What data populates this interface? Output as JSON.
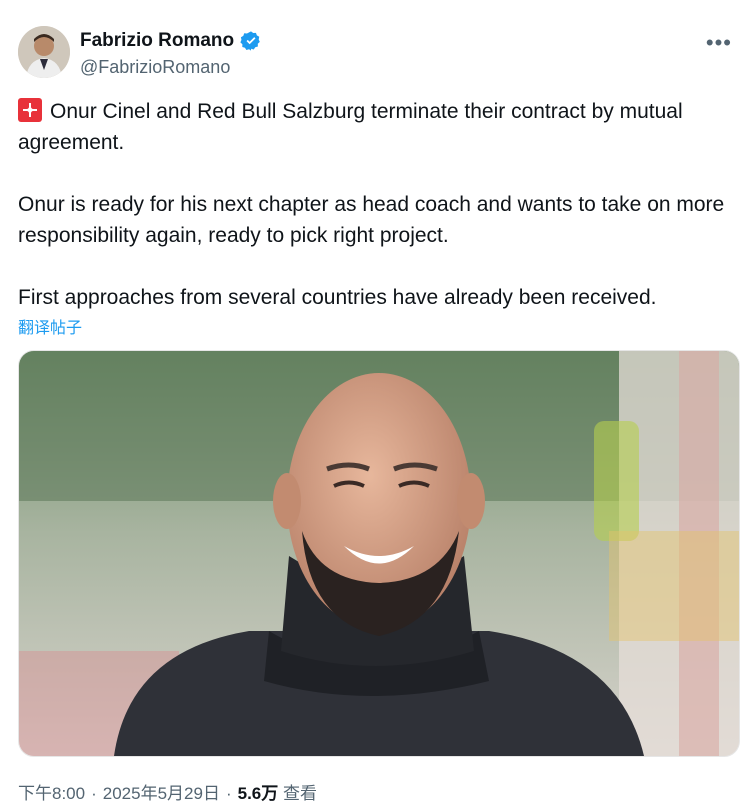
{
  "author": {
    "display_name": "Fabrizio Romano",
    "handle": "@FabrizioRomano",
    "verified_icon": "verified-badge-icon",
    "more_icon": "ellipsis-icon"
  },
  "tweet": {
    "paragraphs": [
      "Onur Cinel and Red Bull Salzburg terminate their contract by mutual agreement.",
      "Onur is ready for his next chapter as head coach and wants to take on more responsibility again, ready to pick right project.",
      "First approaches from several countries have already been received."
    ],
    "leading_icon": "siren-icon",
    "translate_label": "翻译帖子"
  },
  "meta": {
    "time": "下午8:00",
    "separator": "·",
    "date": "2025年5月29日",
    "views_count": "5.6万",
    "views_label": "查看"
  },
  "colors": {
    "link": "#1d9bf0",
    "secondary_text": "#536471",
    "verified": "#1d9bf0"
  }
}
